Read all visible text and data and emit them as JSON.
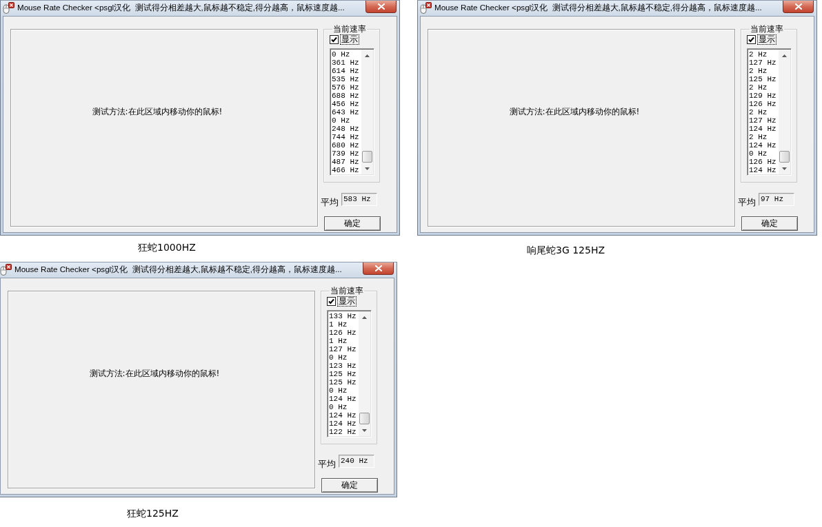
{
  "panels": [
    {
      "window": {
        "title": "Mouse Rate Checker <psgl汉化  测试得分相差越大,鼠标越不稳定,得分越高，鼠标速度越...",
        "test_area_text": "测试方法:在此区域内移动你的鼠标!",
        "rate_group": {
          "title": "当前速率",
          "show_checkbox": {
            "label": "显示",
            "checked": true,
            "focused": true
          },
          "rates": [
            "0 Hz",
            "361 Hz",
            "614 Hz",
            "535 Hz",
            "576 Hz",
            "688 Hz",
            "456 Hz",
            "643 Hz",
            "0 Hz",
            "248 Hz",
            "744 Hz",
            "680 Hz",
            "739 Hz",
            "487 Hz",
            "466 Hz"
          ]
        },
        "average": {
          "label": "平均",
          "value": "583 Hz"
        },
        "ok_button": "确定"
      },
      "caption": "狂蛇1000HZ"
    },
    {
      "window": {
        "title": "Mouse Rate Checker <psgl汉化  测试得分相差越大,鼠标越不稳定,得分越高，鼠标速度越...",
        "test_area_text": "测试方法:在此区域内移动你的鼠标!",
        "rate_group": {
          "title": "当前速率",
          "show_checkbox": {
            "label": "显示",
            "checked": true,
            "focused": true
          },
          "rates": [
            "2 Hz",
            "127 Hz",
            "2 Hz",
            "125 Hz",
            "2 Hz",
            "129 Hz",
            "126 Hz",
            "2 Hz",
            "127 Hz",
            "124 Hz",
            "2 Hz",
            "124 Hz",
            "0 Hz",
            "126 Hz",
            "124 Hz"
          ]
        },
        "average": {
          "label": "平均",
          "value": "97 Hz"
        },
        "ok_button": "确定"
      },
      "caption": "响尾蛇3G 125HZ"
    },
    {
      "window": {
        "title": "Mouse Rate Checker <psgl汉化  测试得分相差越大,鼠标越不稳定,得分越高，鼠标速度越...",
        "test_area_text": "测试方法:在此区域内移动你的鼠标!",
        "rate_group": {
          "title": "当前速率",
          "show_checkbox": {
            "label": "显示",
            "checked": true,
            "focused": true
          },
          "rates": [
            "133 Hz",
            "1 Hz",
            "126 Hz",
            "1 Hz",
            "127 Hz",
            "0 Hz",
            "123 Hz",
            "125 Hz",
            "125 Hz",
            "0 Hz",
            "124 Hz",
            "0 Hz",
            "124 Hz",
            "124 Hz",
            "122 Hz"
          ]
        },
        "average": {
          "label": "平均",
          "value": "240 Hz"
        },
        "ok_button": "确定"
      },
      "caption": "狂蛇125HZ"
    }
  ]
}
